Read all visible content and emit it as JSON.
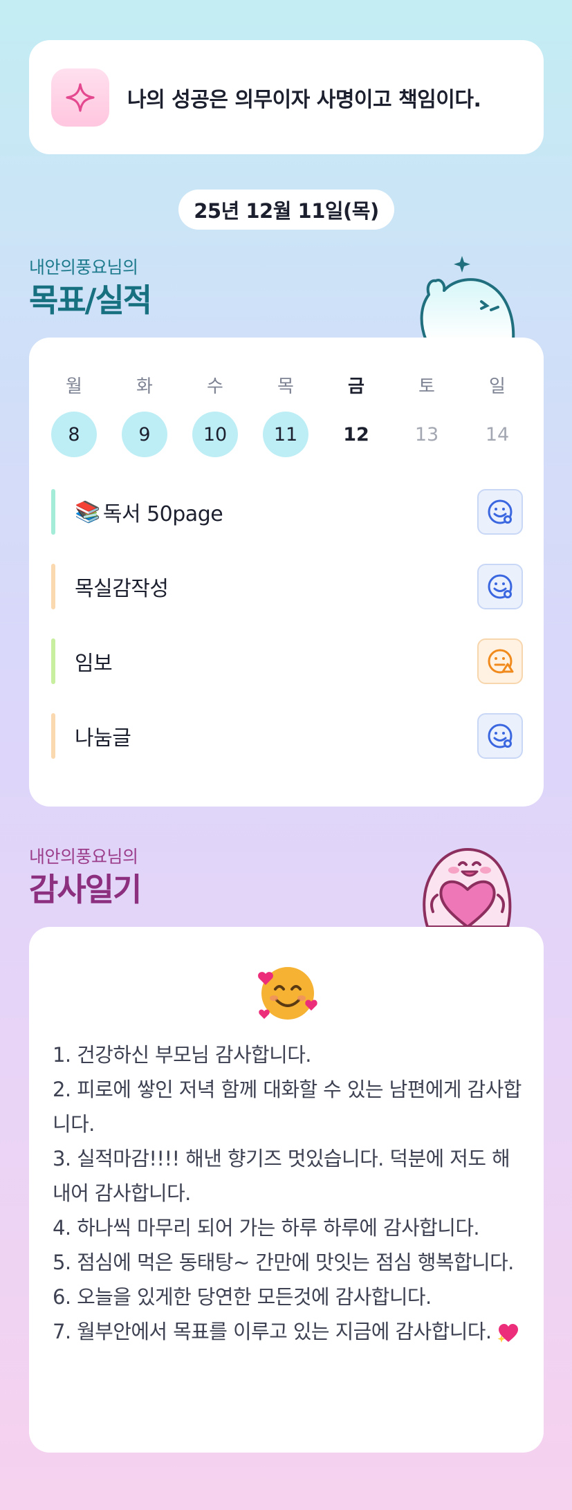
{
  "quote": {
    "icon": "sparkle-icon",
    "text": "나의 성공은 의무이자 사명이고 책임이다."
  },
  "date": "25년 12월 11일(목)",
  "goals_section": {
    "owner": "내안의풍요님의",
    "title": "목표/실적",
    "mascot": "waving-ghost-mascot"
  },
  "week": {
    "days": [
      {
        "weekday": "월",
        "date": "8",
        "state": "done"
      },
      {
        "weekday": "화",
        "date": "9",
        "state": "done"
      },
      {
        "weekday": "수",
        "date": "10",
        "state": "done"
      },
      {
        "weekday": "목",
        "date": "11",
        "state": "done"
      },
      {
        "weekday": "금",
        "date": "12",
        "state": "today"
      },
      {
        "weekday": "토",
        "date": "13",
        "state": "future"
      },
      {
        "weekday": "일",
        "date": "14",
        "state": "future"
      }
    ]
  },
  "goals": [
    {
      "emoji": "📚",
      "label": "독서 50page",
      "bar_color": "#a5ecd8",
      "status": "good",
      "status_icon": "smile-face-icon"
    },
    {
      "emoji": "",
      "label": "목실감작성",
      "bar_color": "#fbd9b0",
      "status": "good",
      "status_icon": "smile-face-icon"
    },
    {
      "emoji": "",
      "label": "임보",
      "bar_color": "#c8ee9f",
      "status": "mid",
      "status_icon": "neutral-face-icon"
    },
    {
      "emoji": "",
      "label": "나눔글",
      "bar_color": "#fbd9b0",
      "status": "good",
      "status_icon": "smile-face-icon"
    }
  ],
  "thanks_section": {
    "owner": "내안의풍요님의",
    "title": "감사일기",
    "mascot": "heart-hugging-mascot"
  },
  "thanks_diary": {
    "emoji": "smiling-face-with-hearts-icon",
    "lines": [
      "1. 건강하신 부모님 감사합니다.",
      "2. 피로에 쌓인 저녁 함께 대화할 수 있는 남편에게 감사합니다.",
      "3. 실적마감!!!! 해낸 향기즈 멋있습니다. 덕분에 저도 해내어 감사합니다.",
      "4. 하나씩 마무리 되어 가는 하루 하루에 감사합니다.",
      "5. 점심에 먹은 동태탕~ 간만에 맛잇는 점심 행복합니다.",
      "6. 오늘을 있게한 당연한 모든것에 감사합니다.",
      "7. 월부안에서 목표를 이루고 있는 지금에 감사합니다."
    ],
    "trailing_icon": "sparkling-heart-icon"
  },
  "colors": {
    "done_day": "#bdeef5",
    "goal_title": "#17707f",
    "thanks_title": "#8c2f7e",
    "good_face": "#3a66e0",
    "mid_face": "#f08a1c"
  }
}
